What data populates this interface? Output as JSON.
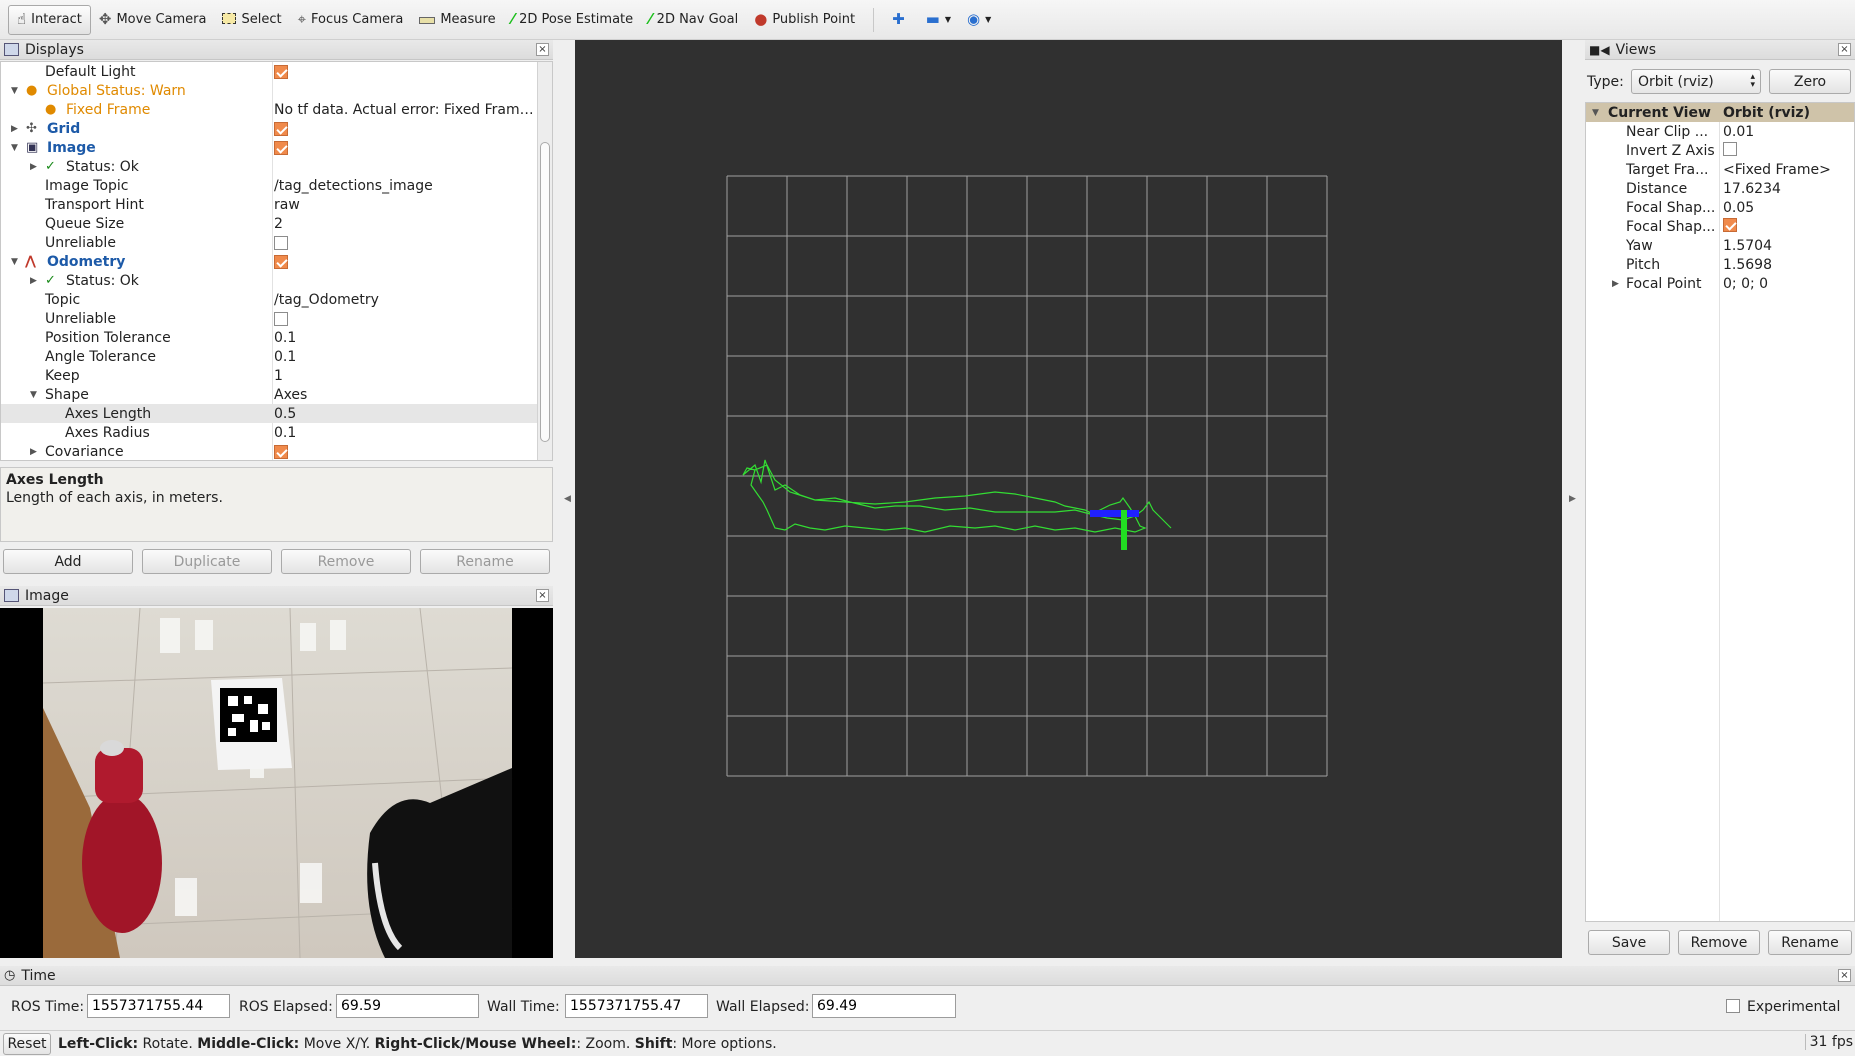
{
  "toolbar": {
    "items": [
      {
        "label": "Interact",
        "icon": "hand-pointer-icon"
      },
      {
        "label": "Move Camera",
        "icon": "move-camera-icon"
      },
      {
        "label": "Select",
        "icon": "select-box-icon"
      },
      {
        "label": "Focus Camera",
        "icon": "focus-crosshair-icon"
      },
      {
        "label": "Measure",
        "icon": "ruler-icon"
      },
      {
        "label": "2D Pose Estimate",
        "icon": "green-arrow-icon"
      },
      {
        "label": "2D Nav Goal",
        "icon": "green-arrow-icon"
      },
      {
        "label": "Publish Point",
        "icon": "map-pin-icon"
      }
    ]
  },
  "displays": {
    "title": "Displays",
    "rows": [
      {
        "name": "Default Light",
        "checked": true
      },
      {
        "name": "Global Status: Warn"
      },
      {
        "name": "Fixed Frame",
        "value": "No tf data.  Actual error: Fixed Fram…"
      },
      {
        "name": "Grid",
        "checked": true
      },
      {
        "name": "Image",
        "checked": true
      },
      {
        "name": "Status: Ok"
      },
      {
        "name": "Image Topic",
        "value": "/tag_detections_image"
      },
      {
        "name": "Transport Hint",
        "value": "raw"
      },
      {
        "name": "Queue Size",
        "value": "2"
      },
      {
        "name": "Unreliable",
        "checked": false
      },
      {
        "name": "Odometry",
        "checked": true
      },
      {
        "name": "Status: Ok"
      },
      {
        "name": "Topic",
        "value": "/tag_Odometry"
      },
      {
        "name": "Unreliable",
        "checked": false
      },
      {
        "name": "Position Tolerance",
        "value": "0.1"
      },
      {
        "name": "Angle Tolerance",
        "value": "0.1"
      },
      {
        "name": "Keep",
        "value": "1"
      },
      {
        "name": "Shape",
        "value": "Axes"
      },
      {
        "name": "Axes Length",
        "value": "0.5"
      },
      {
        "name": "Axes Radius",
        "value": "0.1"
      },
      {
        "name": "Covariance",
        "checked": true
      }
    ],
    "description": {
      "title": "Axes Length",
      "text": "Length of each axis, in meters."
    },
    "buttons": {
      "add": "Add",
      "duplicate": "Duplicate",
      "remove": "Remove",
      "rename": "Rename"
    }
  },
  "image_panel": {
    "title": "Image"
  },
  "views": {
    "title": "Views",
    "type_label": "Type:",
    "type_value": "Orbit (rviz)",
    "zero_button": "Zero",
    "header": {
      "name": "Current View",
      "value": "Orbit (rviz)"
    },
    "props": [
      {
        "name": "Near Clip ...",
        "value": "0.01"
      },
      {
        "name": "Invert Z Axis",
        "checked": false
      },
      {
        "name": "Target Fra...",
        "value": "<Fixed Frame>"
      },
      {
        "name": "Distance",
        "value": "17.6234"
      },
      {
        "name": "Focal Shap...",
        "value": "0.05"
      },
      {
        "name": "Focal Shap...",
        "checked": true
      },
      {
        "name": "Yaw",
        "value": "1.5704"
      },
      {
        "name": "Pitch",
        "value": "1.5698"
      },
      {
        "name": "Focal Point",
        "value": "0; 0; 0"
      }
    ],
    "buttons": {
      "save": "Save",
      "remove": "Remove",
      "rename": "Rename"
    }
  },
  "time": {
    "title": "Time",
    "ros_time_label": "ROS Time:",
    "ros_time": "1557371755.44",
    "ros_elapsed_label": "ROS Elapsed:",
    "ros_elapsed": "69.59",
    "wall_time_label": "Wall Time:",
    "wall_time": "1557371755.47",
    "wall_elapsed_label": "Wall Elapsed:",
    "wall_elapsed": "69.49",
    "experimental_label": "Experimental",
    "experimental_checked": false
  },
  "status": {
    "reset": "Reset",
    "parts": [
      {
        "bold": "Left-Click:",
        "text": " Rotate. "
      },
      {
        "bold": "Middle-Click:",
        "text": " Move X/Y. "
      },
      {
        "bold": "Right-Click/Mouse Wheel:",
        "text": ": Zoom. "
      },
      {
        "bold": "Shift",
        "text": ": More options."
      }
    ],
    "fps": "31 fps"
  },
  "colors": {
    "viewport_bg": "#303030",
    "grid_line": "#a0a0a0",
    "path": "#33dd33",
    "axis_blue": "#2020ff",
    "warn": "#e08a00",
    "link_blue": "#1d5aa8",
    "checkbox_on": "#f08a4b"
  }
}
